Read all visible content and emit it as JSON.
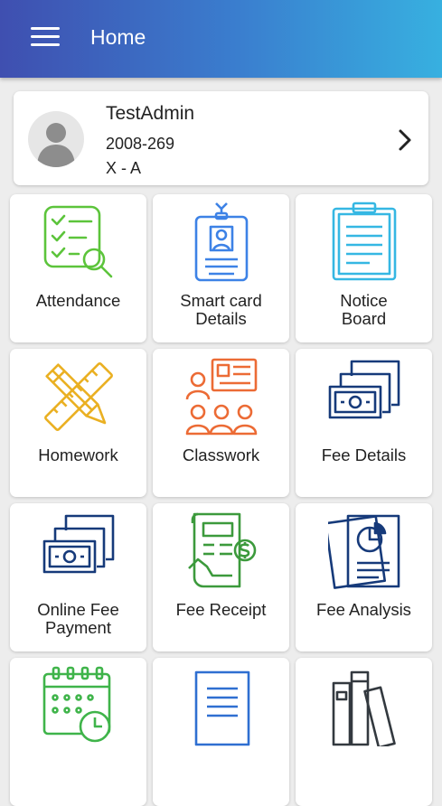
{
  "appbar": {
    "title": "Home"
  },
  "profile": {
    "name": "TestAdmin",
    "id": "2008-269",
    "class": "X - A"
  },
  "tiles": [
    {
      "label": "Attendance",
      "icon": "attendance-checklist-icon",
      "color": "#5cc43b"
    },
    {
      "label": "Smart card\nDetails",
      "icon": "id-card-icon",
      "color": "#3d82e6"
    },
    {
      "label": "Notice\nBoard",
      "icon": "clipboard-icon",
      "color": "#35b7e3"
    },
    {
      "label": "Homework",
      "icon": "pencil-ruler-icon",
      "color": "#eab022"
    },
    {
      "label": "Classwork",
      "icon": "classroom-icon",
      "color": "#ec6b35"
    },
    {
      "label": "Fee Details",
      "icon": "banknotes-icon",
      "color": "#163a7a"
    },
    {
      "label": "Online Fee\nPayment",
      "icon": "banknotes-icon",
      "color": "#163a7a"
    },
    {
      "label": "Fee Receipt",
      "icon": "receipt-icon",
      "color": "#3c9a3c"
    },
    {
      "label": "Fee Analysis",
      "icon": "report-chart-icon",
      "color": "#163a7a"
    },
    {
      "label": "",
      "icon": "calendar-clock-icon",
      "color": "#3fb44a"
    },
    {
      "label": "",
      "icon": "document-icon",
      "color": "#2f6fd1"
    },
    {
      "label": "",
      "icon": "books-icon",
      "color": "#33393f"
    }
  ]
}
